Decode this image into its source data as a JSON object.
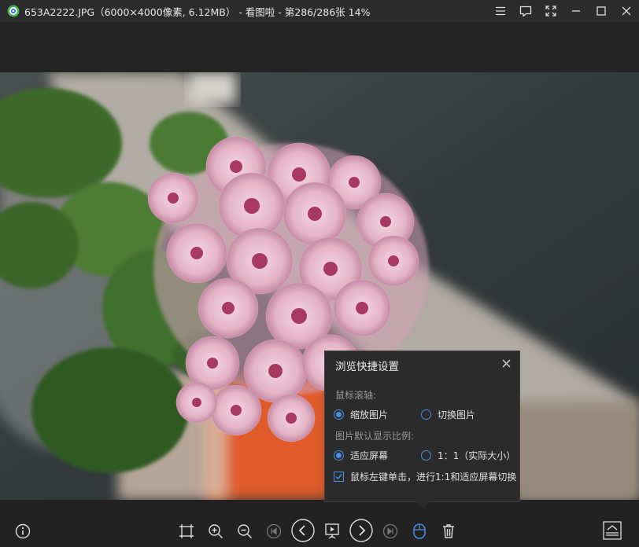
{
  "window": {
    "title": "653A2222.JPG（6000×4000像素, 6.12MB） - 看图啦 - 第286/286张 14%",
    "buttons": [
      "menu-icon",
      "feedback-icon",
      "fullscreen-icon",
      "minimize-icon",
      "maximize-icon",
      "close-icon"
    ]
  },
  "toolbar": {
    "left": [
      "info-icon"
    ],
    "center": [
      "fit-window-icon",
      "zoom-in-icon",
      "zoom-out-icon",
      "first-image-icon",
      "previous-icon",
      "slideshow-icon",
      "next-icon",
      "last-image-icon",
      "mouse-settings-icon",
      "delete-icon"
    ],
    "right": [
      "collapse-icon"
    ],
    "accent": "#4a90e2"
  },
  "settings_panel": {
    "title": "浏览快捷设置",
    "wheel_label": "鼠标滚轴:",
    "wheel_options": [
      "缩放图片",
      "切换图片"
    ],
    "wheel_selected": "缩放图片",
    "ratio_label": "图片默认显示比例:",
    "ratio_options": [
      "适应屏幕",
      "1：1（实际大小）"
    ],
    "ratio_selected": "适应屏幕",
    "checkbox_label": "鼠标左键单击，进行1:1和适应屏幕切换",
    "checkbox_checked": true
  }
}
